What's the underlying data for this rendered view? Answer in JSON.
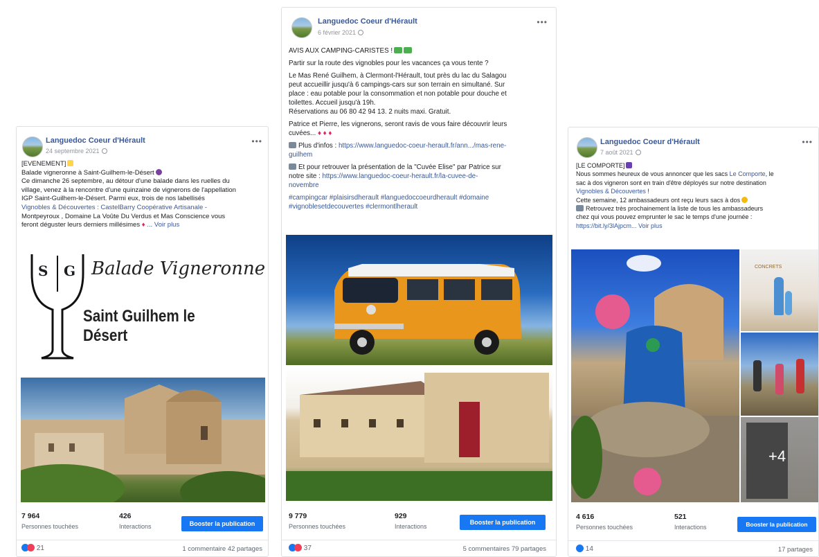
{
  "posts": [
    {
      "page_name": "Languedoc Coeur d'Hérault",
      "date": "24 septembre 2021",
      "more": "•••",
      "tag_line": "[EVENEMENT]",
      "lines": [
        "Balade vigneronne à Saint-Guilhem-le-Désert",
        "Ce dimanche 26 septembre, au détour d'une balade dans les ruelles du",
        "village, venez à la rencontre d'une quinzaine de vignerons de l'appellation",
        "IGP Saint-Guilhem-le-Désert. Parmi eux, trois de nos labellisés"
      ],
      "link_line": "Vignobles & Découvertes : CastelBarry Coopérative Artisanale -",
      "line_mid": "Montpeyroux , Domaine La Voûte Du Verdus et Mas Conscience vous",
      "line_last": "feront déguster leurs derniers millésimes",
      "see_more": "... Voir plus",
      "logo_letters": [
        "S",
        "G"
      ],
      "logo_script": "Balade Vigneronne",
      "logo_title": "Saint Guilhem le Désert",
      "reach": "7 964",
      "reach_label": "Personnes touchées",
      "interactions": "426",
      "interactions_label": "Interactions",
      "boost": "Booster la publication",
      "reactions": "21",
      "meta": "1 commentaire  42 partages"
    },
    {
      "page_name": "Languedoc Coeur d'Hérault",
      "date": "6 février 2021",
      "more": "•••",
      "title": "AVIS AUX CAMPING-CARISTES !",
      "p1": "Partir sur la route des vignobles pour les vacances ça vous tente ?",
      "p2": [
        "Le Mas René Guilhem, à Clermont-l'Hérault, tout près du lac du Salagou",
        "peut accueillir jusqu'à 6 campings-cars sur son terrain en simultané. Sur",
        "place : eau potable pour la consommation et non potable pour douche et",
        "toilettes. Accueil jusqu'à 19h.",
        "Réservations au 06 80 42 94 13. 2 nuits maxi. Gratuit."
      ],
      "p3": [
        "Patrice et Pierre, les vignerons, seront ravis de vous faire découvrir leurs",
        "cuvées..."
      ],
      "info_prefix": "Plus d'infos : ",
      "info_link": "https://www.languedoc-coeur-herault.fr/ann.../mas-rene-",
      "info_link2": "guilhem",
      "p4_a": "Et pour retrouver la présentation de la \"Cuvée Elise\" par Patrice sur",
      "p4_b": "notre site : ",
      "p4_link": "https://www.languedoc-coeur-herault.fr/la-cuvee-de-",
      "p4_link2": "novembre",
      "tags1": "#campingcar #plaisirsdherault #languedoccoeurdherault #domaine",
      "tags2": "#vignoblesetdecouvertes #clermontlherault",
      "reach": "9 779",
      "reach_label": "Personnes touchées",
      "interactions": "929",
      "interactions_label": "Interactions",
      "boost": "Booster la publication",
      "reactions": "37",
      "meta": "5 commentaires  79 partages"
    },
    {
      "page_name": "Languedoc Coeur d'Hérault",
      "date": "7 août 2021",
      "more": "•••",
      "tag_line": "[LE COMPORTE]",
      "l1_a": "Nous sommes heureux de vous annoncer que les sacs ",
      "l1_link": "Le Comporte",
      "l1_b": ", le",
      "l2": "sac à dos vigneron sont en train d'être déployés sur notre destination",
      "l3_link": "Vignobles & Découvertes",
      "l3_b": " !",
      "l4": "Cette semaine, 12 ambassadeurs ont reçu leurs sacs à dos",
      "l5": "Retrouvez très prochainement la liste de tous les ambassadeurs",
      "l6": "chez qui vous pouvez emprunter le sac le temps d'une journée :",
      "l7_link": "https://bit.ly/3lAjpcm...",
      "see_more": "Voir plus",
      "plus_count": "+4",
      "sign": "CONCRETS",
      "reach": "4 616",
      "reach_label": "Personnes touchées",
      "interactions": "521",
      "interactions_label": "Interactions",
      "boost": "Booster la publication",
      "reactions": "14",
      "meta": "17 partages"
    }
  ],
  "colors": {
    "link": "#385898",
    "boost": "#1877f2",
    "like": "#1877f2",
    "love": "#f33e58"
  }
}
